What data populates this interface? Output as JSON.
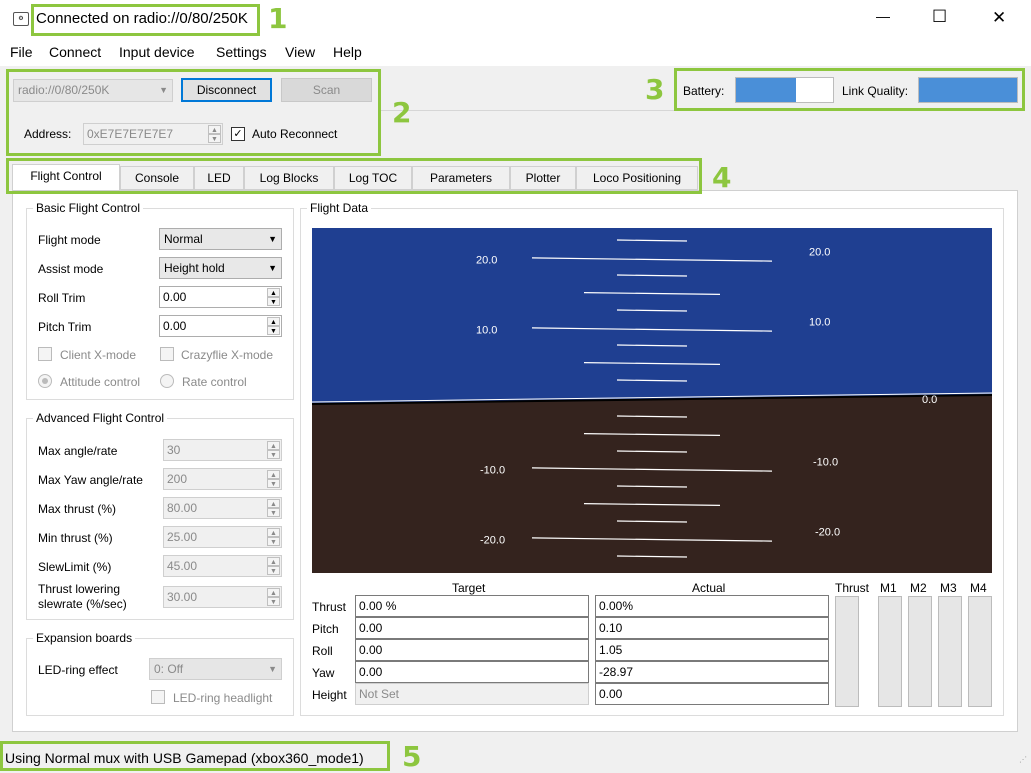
{
  "window": {
    "title": "Connected on radio://0/80/250K",
    "controls": {
      "minimize": "—",
      "maximize": "☐",
      "close": "✕"
    }
  },
  "menu": [
    "File",
    "Connect",
    "Input device",
    "Settings",
    "View",
    "Help"
  ],
  "connection": {
    "uri": "radio://0/80/250K",
    "disconnect_label": "Disconnect",
    "scan_label": "Scan",
    "address_label": "Address:",
    "address_value": "0xE7E7E7E7E7",
    "auto_reconnect_label": "Auto Reconnect",
    "auto_reconnect_checked": true
  },
  "status_bars": {
    "battery_label": "Battery:",
    "battery_fill": 0.62,
    "link_label": "Link Quality:",
    "link_fill": 1.0,
    "fill_color": "#4a8fd8"
  },
  "tabs": [
    "Flight Control",
    "Console",
    "LED",
    "Log Blocks",
    "Log TOC",
    "Parameters",
    "Plotter",
    "Loco Positioning"
  ],
  "callouts": [
    "1",
    "2",
    "3",
    "4",
    "5"
  ],
  "basic": {
    "title": "Basic Flight Control",
    "flight_mode_label": "Flight mode",
    "flight_mode_value": "Normal",
    "assist_mode_label": "Assist mode",
    "assist_mode_value": "Height hold",
    "roll_trim_label": "Roll Trim",
    "roll_trim_value": "0.00",
    "pitch_trim_label": "Pitch Trim",
    "pitch_trim_value": "0.00",
    "client_x_label": "Client X-mode",
    "crazyflie_x_label": "Crazyflie X-mode",
    "attitude_label": "Attitude control",
    "rate_label": "Rate control"
  },
  "advanced": {
    "title": "Advanced Flight Control",
    "rows": [
      {
        "label": "Max angle/rate",
        "value": "30"
      },
      {
        "label": "Max Yaw angle/rate",
        "value": "200"
      },
      {
        "label": "Max thrust (%)",
        "value": "80.00"
      },
      {
        "label": "Min thrust (%)",
        "value": "25.00"
      },
      {
        "label": "SlewLimit (%)",
        "value": "45.00"
      },
      {
        "label": "Thrust lowering slewrate (%/sec)",
        "value": "30.00"
      }
    ]
  },
  "expansion": {
    "title": "Expansion boards",
    "led_ring_label": "LED-ring effect",
    "led_ring_value": "0: Off",
    "headlight_label": "LED-ring headlight"
  },
  "flight_data": {
    "title": "Flight Data",
    "sky_color": "#1f3f91",
    "ground_color": "#34231e",
    "horizon_label": "0.0",
    "pitch_labels": [
      "20.0",
      "10.0",
      "-10.0",
      "-20.0"
    ],
    "target_header": "Target",
    "actual_header": "Actual",
    "rows": [
      {
        "label": "Thrust",
        "target": "0.00 %",
        "actual": "0.00%"
      },
      {
        "label": "Pitch",
        "target": "0.00",
        "actual": "0.10"
      },
      {
        "label": "Roll",
        "target": "0.00",
        "actual": "1.05"
      },
      {
        "label": "Yaw",
        "target": "0.00",
        "actual": "-28.97"
      },
      {
        "label": "Height",
        "target": "Not Set",
        "actual": "0.00"
      }
    ],
    "motor_headers": [
      "Thrust",
      "M1",
      "M2",
      "M3",
      "M4"
    ]
  },
  "statusbar": {
    "text": "Using Normal mux with USB Gamepad  (xbox360_mode1)"
  }
}
